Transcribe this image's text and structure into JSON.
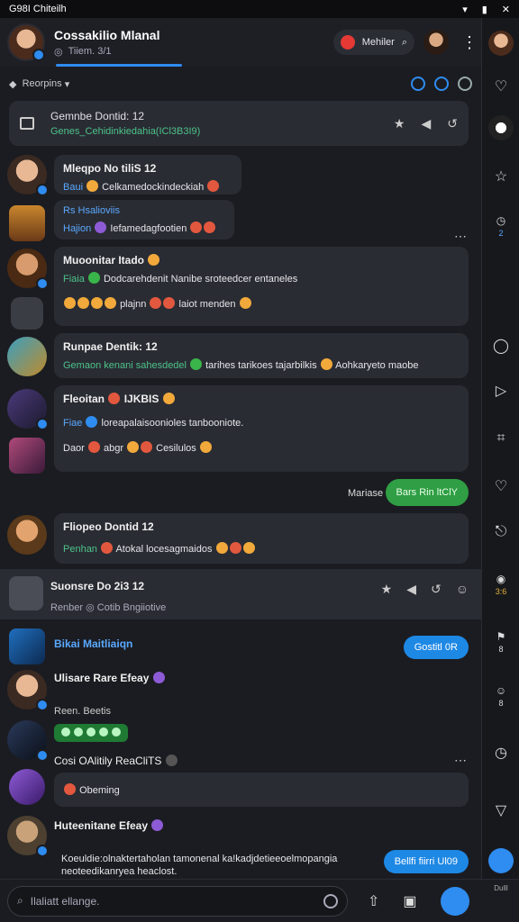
{
  "status": {
    "time": "G98I Chiteilh"
  },
  "header": {
    "title": "Cossakilio Mlanal",
    "subtitle": "Tiiem. 3/1",
    "pill_label": "Mehiler"
  },
  "filter": {
    "label": "Reorpins"
  },
  "pinned": {
    "line1": "Gemnbe Dontid: 12",
    "line2_prefix": "Genes_",
    "line2_rest": "Cehidinkiedahia(ICl3B3I9)"
  },
  "messages": [
    {
      "name": "Mleqpo No tiliS 12",
      "line1_tag": "Baui",
      "line1": "Celkamedockindeckiah",
      "line2_tag": "Hajion",
      "line2_tag_prefix": "Rs Hsalioviis",
      "line2": "Iefamedagfootien"
    },
    {
      "name": "Muoonitar Itado",
      "line1_tag": "Fiaia",
      "line1": "Dodcarehdenit Nanibe sroteedcer entaneles",
      "line2": "plajnn",
      "line2_suffix": "laiot menden"
    },
    {
      "name": "Runpae Dentik: 12",
      "line1_tag": "Gemaon kenani sahesdedel",
      "line1": "tarihes tarikoes tajarbilkis",
      "line1_suffix": "Aohkaryeto maobe"
    },
    {
      "name": "Fleoitan",
      "name_suffix": "IJKBIS",
      "line1_tag": "Fiae",
      "line1": "loreapalaisoonioles tanbooniote.",
      "line2_tag": "Daor",
      "line2": "abgr",
      "line2_suffix": "Cesilulos"
    }
  ],
  "outgoing": {
    "label": "Mariase",
    "text": "Bars Rin ltClY"
  },
  "message5": {
    "name": "Fliopeo Dontid 12",
    "line1_tag": "Penhan",
    "line1": "Atokal locesagmaidos"
  },
  "section2": {
    "name": "Suonsre Do 2i3 12",
    "sub": "Renber",
    "sub_rest": "Cotib Bngiiotive"
  },
  "chat2": [
    {
      "name": "Bikai Maitliaiqn",
      "button": "Gostitl 0R"
    },
    {
      "name": "Ulisare Rare Efeay",
      "sub": "Reen. Beetis"
    },
    {
      "name": "Cosi OAlitily ReaCliTS"
    },
    {
      "name": "Obeming"
    },
    {
      "name": "Huteenitane Efeay",
      "text1": "Koeuldie:olnaktertaholan tamonenal ka!kadjdetieeoelmopangia",
      "text2": "neoteedikanryea heaclost.",
      "button": "Bellfi fiirri Ul09"
    }
  ],
  "composer": {
    "placeholder": "Ilaliatt ellange."
  },
  "sidebar": {
    "num1": "2",
    "num2": "3:6",
    "num3": "8",
    "num4": "8",
    "num5": "Dulll"
  }
}
